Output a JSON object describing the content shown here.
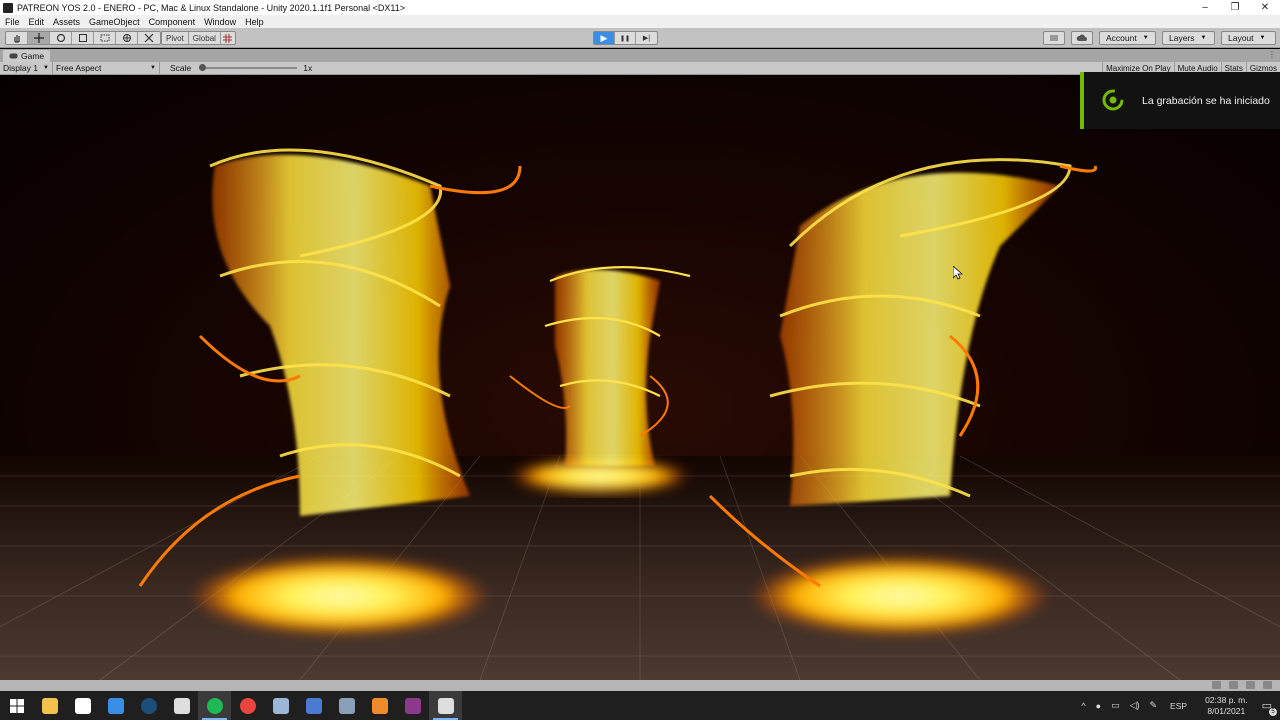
{
  "window": {
    "title": "PATREON YOS 2.0 - ENERO - PC, Mac & Linux Standalone - Unity 2020.1.1f1 Personal <DX11>",
    "minimize": "–",
    "maximize": "❐",
    "close": "✕"
  },
  "menu": [
    "File",
    "Edit",
    "Assets",
    "GameObject",
    "Component",
    "Window",
    "Help"
  ],
  "toolbar": {
    "tools": [
      "hand-icon",
      "move-icon",
      "rotate-icon",
      "scale-icon",
      "rect-icon",
      "transform-icon",
      "custom-tool-icon"
    ],
    "pivot_label": "Pivot",
    "global_label": "Global",
    "play_icon": "▶",
    "pause_icon": "❚❚",
    "step_icon": "▶|",
    "account_label": "Account",
    "layers_label": "Layers",
    "layout_label": "Layout"
  },
  "game_view": {
    "tab_label": "Game",
    "display": "Display 1",
    "aspect": "Free Aspect",
    "scale_label": "Scale",
    "scale_value": "1x",
    "scale_fraction": 0,
    "maximize_on_play": "Maximize On Play",
    "mute_audio": "Mute Audio",
    "stats": "Stats",
    "gizmos": "Gizmos"
  },
  "notification": {
    "text": "La grabación se ha iniciado",
    "accent": "#76b900"
  },
  "taskbar": {
    "apps": [
      {
        "name": "file-explorer-icon",
        "color": "#f2c14e",
        "glyph": ""
      },
      {
        "name": "store-icon",
        "color": "#ffffff",
        "glyph": ""
      },
      {
        "name": "mail-icon",
        "color": "#3a8ee6",
        "glyph": ""
      },
      {
        "name": "steam-icon",
        "color": "#1b4f7a",
        "glyph": ""
      },
      {
        "name": "unity-hub-icon",
        "color": "#dddddd",
        "glyph": ""
      },
      {
        "name": "spotify-icon",
        "color": "#1db954",
        "glyph": ""
      },
      {
        "name": "chrome-icon",
        "color": "#e8453c",
        "glyph": ""
      },
      {
        "name": "app-icon",
        "color": "#9bb6d6",
        "glyph": ""
      },
      {
        "name": "calculator-icon",
        "color": "#4a7bd0",
        "glyph": ""
      },
      {
        "name": "photos-icon",
        "color": "#8aa0b8",
        "glyph": ""
      },
      {
        "name": "blender-icon",
        "color": "#f08b2c",
        "glyph": ""
      },
      {
        "name": "winrar-icon",
        "color": "#8b3a8b",
        "glyph": ""
      },
      {
        "name": "unity-editor-icon",
        "color": "#dddddd",
        "glyph": ""
      }
    ],
    "language": "ESP",
    "time": "02:38 p. m.",
    "date": "8/01/2021",
    "notification_count": "5"
  },
  "colors": {
    "fire_core": "#fff35a",
    "fire_mid": "#ffb000",
    "fire_edge": "#ff4a00"
  }
}
